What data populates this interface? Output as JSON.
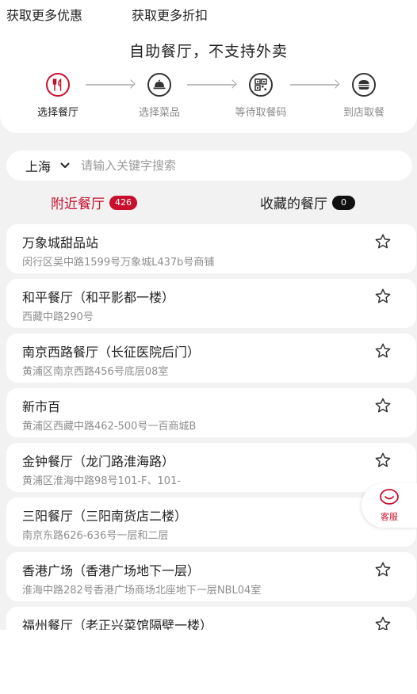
{
  "promos": {
    "left_label": "获取更多优惠",
    "right_label": "获取更多折扣"
  },
  "page_title": "自助餐厅，不支持外卖",
  "steps": [
    {
      "label": "选择餐厅",
      "icon": "fork-knife-icon",
      "active": true
    },
    {
      "label": "选择菜品",
      "icon": "cloche-icon",
      "active": false
    },
    {
      "label": "等待取餐码",
      "icon": "qr-code-icon",
      "active": false
    },
    {
      "label": "到店取餐",
      "icon": "burger-icon",
      "active": false
    }
  ],
  "search": {
    "city": "上海",
    "placeholder": "请输入关键字搜索",
    "value": ""
  },
  "tabs": {
    "nearby_label": "附近餐厅",
    "nearby_count": "426",
    "favorites_label": "收藏的餐厅",
    "favorites_count": "0"
  },
  "restaurants": [
    {
      "name": "万象城甜品站",
      "address": "闵行区吴中路1599号万象城L437b号商铺"
    },
    {
      "name": "和平餐厅（和平影都一楼）",
      "address": "西藏中路290号"
    },
    {
      "name": "南京西路餐厅（长征医院后门）",
      "address": "黄浦区南京西路456号底层08室"
    },
    {
      "name": "新市百",
      "address": "黄浦区西藏中路462-500号一百商城B"
    },
    {
      "name": "金钟餐厅（龙门路淮海路）",
      "address": "黄浦区淮海中路98号101-F、101-"
    },
    {
      "name": "三阳餐厅（三阳南货店二楼）",
      "address": "南京东路626-636号一层和二层"
    },
    {
      "name": "香港广场（香港广场地下一层）",
      "address": "淮海中路282号香港广场商场北座地下一层NBL04室"
    },
    {
      "name": "福州餐厅（老正兴菜馆隔壁一楼）",
      "address": ""
    }
  ],
  "customer_service": {
    "label": "客服",
    "icon": "smiley-icon"
  },
  "colors": {
    "accent": "#c8102e",
    "background": "#f2f2f2",
    "card": "#ffffff"
  }
}
